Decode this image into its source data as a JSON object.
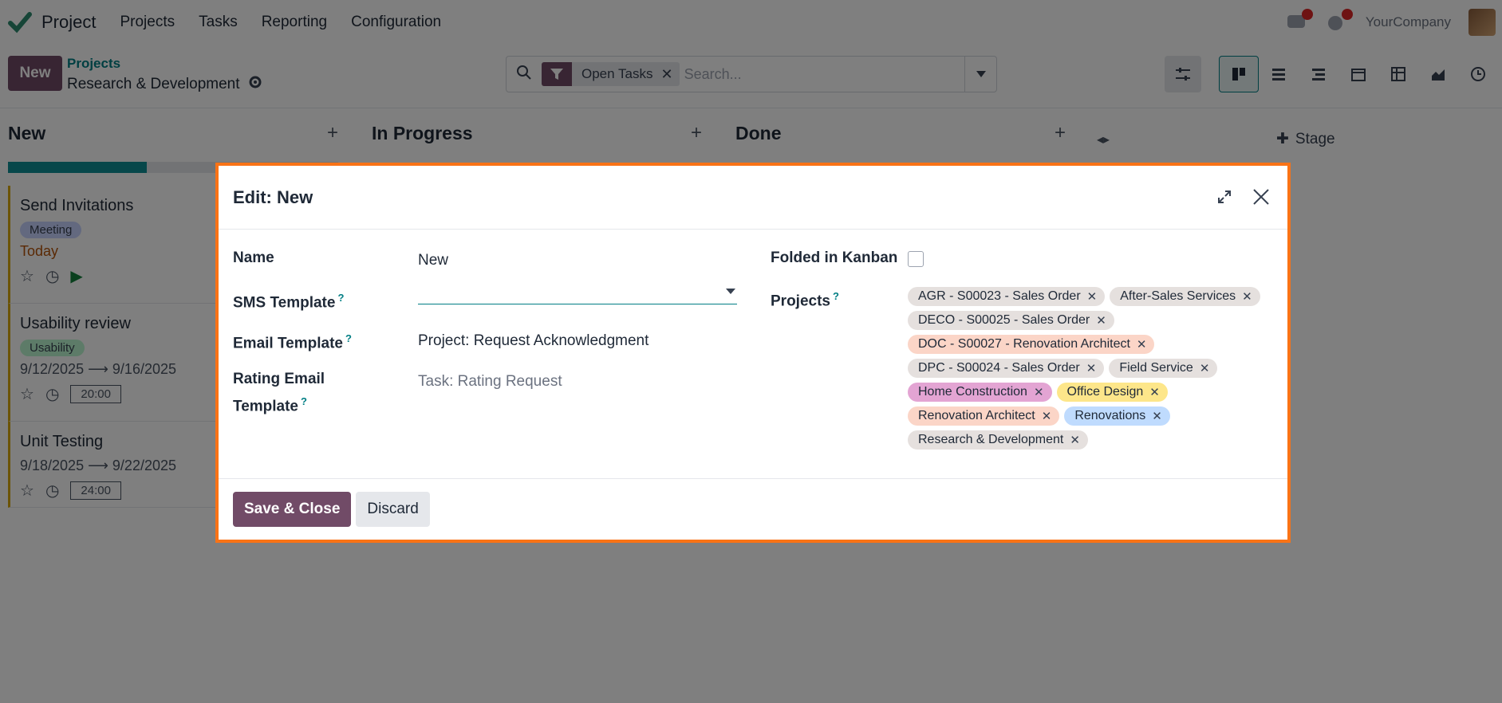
{
  "app": {
    "name": "Project",
    "company": "YourCompany"
  },
  "nav": {
    "items": [
      "Projects",
      "Tasks",
      "Reporting",
      "Configuration"
    ]
  },
  "control": {
    "new_label": "New",
    "breadcrumb_parent": "Projects",
    "breadcrumb_current": "Research & Development",
    "facet_label": "Open Tasks",
    "search_placeholder": "Search..."
  },
  "kanban": {
    "columns": [
      {
        "title": "New",
        "progress": 0.42
      },
      {
        "title": "In Progress"
      },
      {
        "title": "Done"
      }
    ],
    "add_stage_label": "Stage",
    "cards": [
      {
        "title": "Send Invitations",
        "tag": "Meeting",
        "meta": "Today"
      },
      {
        "title": "Usability review",
        "tag": "Usability",
        "date_start": "9/12/2025",
        "date_end": "9/16/2025",
        "hours": "20:00"
      },
      {
        "title": "Unit Testing",
        "date_start": "9/18/2025",
        "date_end": "9/22/2025",
        "hours": "24:00"
      }
    ]
  },
  "modal": {
    "title": "Edit: New",
    "fields": {
      "name_label": "Name",
      "name_value": "New",
      "sms_label": "SMS Template",
      "email_label": "Email Template",
      "email_value": "Project: Request Acknowledgment",
      "rating_label_line1": "Rating Email",
      "rating_label_line2": "Template",
      "rating_value": "Task: Rating Request",
      "folded_label": "Folded in Kanban",
      "folded_checked": false,
      "projects_label": "Projects",
      "help_mark": "?"
    },
    "project_tags": [
      {
        "label": "AGR - S00023 - Sales Order",
        "color": "#e5e0de"
      },
      {
        "label": "After-Sales Services",
        "color": "#e5e0de"
      },
      {
        "label": "DECO - S00025 - Sales Order",
        "color": "#e5e0de"
      },
      {
        "label": "DOC - S00027 - Renovation Architect",
        "color": "#fbd5c7"
      },
      {
        "label": "DPC - S00024 - Sales Order",
        "color": "#e5e0de"
      },
      {
        "label": "Field Service",
        "color": "#e5e0de"
      },
      {
        "label": "Home Construction",
        "color": "#e3a4d3"
      },
      {
        "label": "Office Design",
        "color": "#fde68a"
      },
      {
        "label": "Renovation Architect",
        "color": "#fbd5c7"
      },
      {
        "label": "Renovations",
        "color": "#bfdbfe"
      },
      {
        "label": "Research & Development",
        "color": "#e5e0de"
      }
    ],
    "save_label": "Save & Close",
    "discard_label": "Discard"
  },
  "colors": {
    "brand": "#714b67",
    "accent": "#017e84",
    "highlight": "#f97316"
  }
}
